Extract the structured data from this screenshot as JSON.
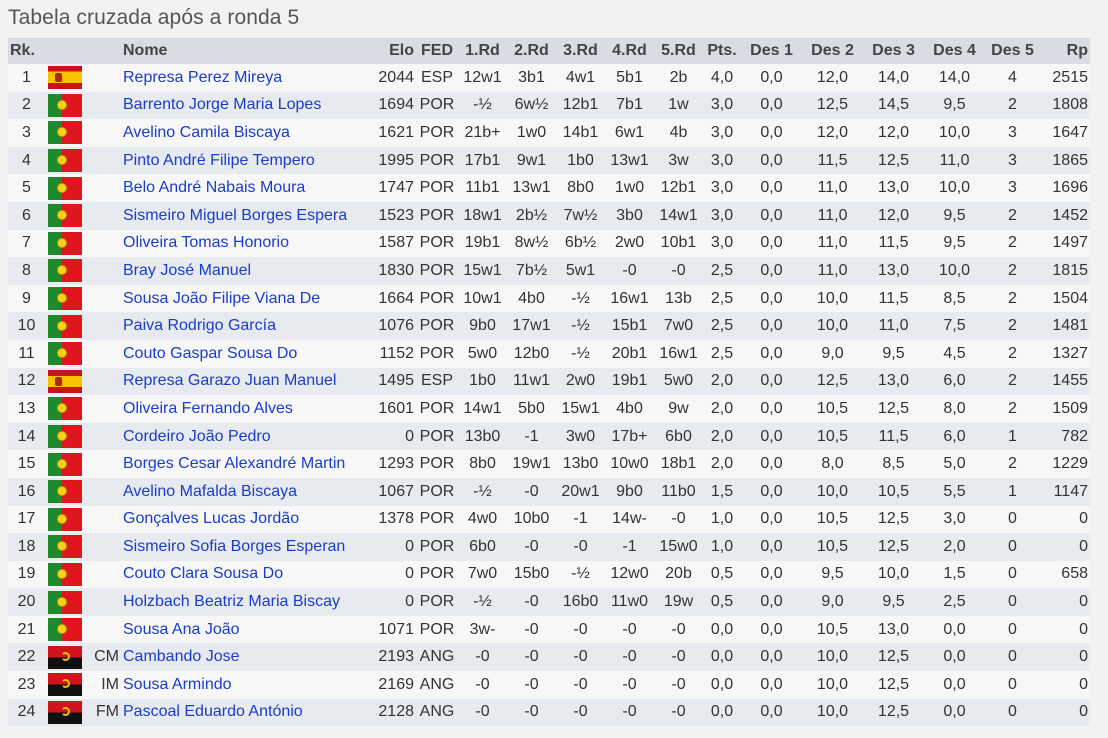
{
  "page": {
    "title": "Tabela cruzada após a ronda 5"
  },
  "columns": [
    "Rk.",
    "",
    "",
    "Nome",
    "Elo",
    "FED",
    "1.Rd",
    "2.Rd",
    "3.Rd",
    "4.Rd",
    "5.Rd",
    "Pts.",
    "Des 1",
    "Des 2",
    "Des 3",
    "Des 4",
    "Des 5",
    "Rp"
  ],
  "rows": [
    {
      "rk": "1",
      "flag": "esp",
      "title": "",
      "name": "Represa Perez Mireya",
      "elo": "2044",
      "fed": "ESP",
      "r1": "12w1",
      "r2": "3b1",
      "r3": "4w1",
      "r4": "5b1",
      "r5": "2b",
      "pts": "4,0",
      "d1": "0,0",
      "d2": "12,0",
      "d3": "14,0",
      "d4": "14,0",
      "d5": "4",
      "rp": "2515"
    },
    {
      "rk": "2",
      "flag": "por",
      "title": "",
      "name": "Barrento Jorge Maria Lopes",
      "elo": "1694",
      "fed": "POR",
      "r1": "-½",
      "r2": "6w½",
      "r3": "12b1",
      "r4": "7b1",
      "r5": "1w",
      "pts": "3,0",
      "d1": "0,0",
      "d2": "12,5",
      "d3": "14,5",
      "d4": "9,5",
      "d5": "2",
      "rp": "1808"
    },
    {
      "rk": "3",
      "flag": "por",
      "title": "",
      "name": "Avelino Camila Biscaya",
      "elo": "1621",
      "fed": "POR",
      "r1": "21b+",
      "r2": "1w0",
      "r3": "14b1",
      "r4": "6w1",
      "r5": "4b",
      "pts": "3,0",
      "d1": "0,0",
      "d2": "12,0",
      "d3": "12,0",
      "d4": "10,0",
      "d5": "3",
      "rp": "1647"
    },
    {
      "rk": "4",
      "flag": "por",
      "title": "",
      "name": "Pinto André Filipe Tempero",
      "elo": "1995",
      "fed": "POR",
      "r1": "17b1",
      "r2": "9w1",
      "r3": "1b0",
      "r4": "13w1",
      "r5": "3w",
      "pts": "3,0",
      "d1": "0,0",
      "d2": "11,5",
      "d3": "12,5",
      "d4": "11,0",
      "d5": "3",
      "rp": "1865"
    },
    {
      "rk": "5",
      "flag": "por",
      "title": "",
      "name": "Belo André Nabais Moura",
      "elo": "1747",
      "fed": "POR",
      "r1": "11b1",
      "r2": "13w1",
      "r3": "8b0",
      "r4": "1w0",
      "r5": "12b1",
      "pts": "3,0",
      "d1": "0,0",
      "d2": "11,0",
      "d3": "13,0",
      "d4": "10,0",
      "d5": "3",
      "rp": "1696"
    },
    {
      "rk": "6",
      "flag": "por",
      "title": "",
      "name": "Sismeiro Miguel Borges Espera",
      "elo": "1523",
      "fed": "POR",
      "r1": "18w1",
      "r2": "2b½",
      "r3": "7w½",
      "r4": "3b0",
      "r5": "14w1",
      "pts": "3,0",
      "d1": "0,0",
      "d2": "11,0",
      "d3": "12,0",
      "d4": "9,5",
      "d5": "2",
      "rp": "1452"
    },
    {
      "rk": "7",
      "flag": "por",
      "title": "",
      "name": "Oliveira Tomas Honorio",
      "elo": "1587",
      "fed": "POR",
      "r1": "19b1",
      "r2": "8w½",
      "r3": "6b½",
      "r4": "2w0",
      "r5": "10b1",
      "pts": "3,0",
      "d1": "0,0",
      "d2": "11,0",
      "d3": "11,5",
      "d4": "9,5",
      "d5": "2",
      "rp": "1497"
    },
    {
      "rk": "8",
      "flag": "por",
      "title": "",
      "name": "Bray José Manuel",
      "elo": "1830",
      "fed": "POR",
      "r1": "15w1",
      "r2": "7b½",
      "r3": "5w1",
      "r4": "-0",
      "r5": "-0",
      "pts": "2,5",
      "d1": "0,0",
      "d2": "11,0",
      "d3": "13,0",
      "d4": "10,0",
      "d5": "2",
      "rp": "1815"
    },
    {
      "rk": "9",
      "flag": "por",
      "title": "",
      "name": "Sousa João Filipe Viana De",
      "elo": "1664",
      "fed": "POR",
      "r1": "10w1",
      "r2": "4b0",
      "r3": "-½",
      "r4": "16w1",
      "r5": "13b",
      "pts": "2,5",
      "d1": "0,0",
      "d2": "10,0",
      "d3": "11,5",
      "d4": "8,5",
      "d5": "2",
      "rp": "1504"
    },
    {
      "rk": "10",
      "flag": "por",
      "title": "",
      "name": "Paiva Rodrigo García",
      "elo": "1076",
      "fed": "POR",
      "r1": "9b0",
      "r2": "17w1",
      "r3": "-½",
      "r4": "15b1",
      "r5": "7w0",
      "pts": "2,5",
      "d1": "0,0",
      "d2": "10,0",
      "d3": "11,0",
      "d4": "7,5",
      "d5": "2",
      "rp": "1481"
    },
    {
      "rk": "11",
      "flag": "por",
      "title": "",
      "name": "Couto Gaspar Sousa Do",
      "elo": "1152",
      "fed": "POR",
      "r1": "5w0",
      "r2": "12b0",
      "r3": "-½",
      "r4": "20b1",
      "r5": "16w1",
      "pts": "2,5",
      "d1": "0,0",
      "d2": "9,0",
      "d3": "9,5",
      "d4": "4,5",
      "d5": "2",
      "rp": "1327"
    },
    {
      "rk": "12",
      "flag": "esp",
      "title": "",
      "name": "Represa Garazo Juan Manuel",
      "elo": "1495",
      "fed": "ESP",
      "r1": "1b0",
      "r2": "11w1",
      "r3": "2w0",
      "r4": "19b1",
      "r5": "5w0",
      "pts": "2,0",
      "d1": "0,0",
      "d2": "12,5",
      "d3": "13,0",
      "d4": "6,0",
      "d5": "2",
      "rp": "1455"
    },
    {
      "rk": "13",
      "flag": "por",
      "title": "",
      "name": "Oliveira Fernando Alves",
      "elo": "1601",
      "fed": "POR",
      "r1": "14w1",
      "r2": "5b0",
      "r3": "15w1",
      "r4": "4b0",
      "r5": "9w",
      "pts": "2,0",
      "d1": "0,0",
      "d2": "10,5",
      "d3": "12,5",
      "d4": "8,0",
      "d5": "2",
      "rp": "1509"
    },
    {
      "rk": "14",
      "flag": "por",
      "title": "",
      "name": "Cordeiro João Pedro",
      "elo": "0",
      "fed": "POR",
      "r1": "13b0",
      "r2": "-1",
      "r3": "3w0",
      "r4": "17b+",
      "r5": "6b0",
      "pts": "2,0",
      "d1": "0,0",
      "d2": "10,5",
      "d3": "11,5",
      "d4": "6,0",
      "d5": "1",
      "rp": "782"
    },
    {
      "rk": "15",
      "flag": "por",
      "title": "",
      "name": "Borges Cesar Alexandré Martin",
      "elo": "1293",
      "fed": "POR",
      "r1": "8b0",
      "r2": "19w1",
      "r3": "13b0",
      "r4": "10w0",
      "r5": "18b1",
      "pts": "2,0",
      "d1": "0,0",
      "d2": "8,0",
      "d3": "8,5",
      "d4": "5,0",
      "d5": "2",
      "rp": "1229"
    },
    {
      "rk": "16",
      "flag": "por",
      "title": "",
      "name": "Avelino Mafalda Biscaya",
      "elo": "1067",
      "fed": "POR",
      "r1": "-½",
      "r2": "-0",
      "r3": "20w1",
      "r4": "9b0",
      "r5": "11b0",
      "pts": "1,5",
      "d1": "0,0",
      "d2": "10,0",
      "d3": "10,5",
      "d4": "5,5",
      "d5": "1",
      "rp": "1147"
    },
    {
      "rk": "17",
      "flag": "por",
      "title": "",
      "name": "Gonçalves Lucas Jordão",
      "elo": "1378",
      "fed": "POR",
      "r1": "4w0",
      "r2": "10b0",
      "r3": "-1",
      "r4": "14w-",
      "r5": "-0",
      "pts": "1,0",
      "d1": "0,0",
      "d2": "10,5",
      "d3": "12,5",
      "d4": "3,0",
      "d5": "0",
      "rp": "0"
    },
    {
      "rk": "18",
      "flag": "por",
      "title": "",
      "name": "Sismeiro Sofia Borges Esperan",
      "elo": "0",
      "fed": "POR",
      "r1": "6b0",
      "r2": "-0",
      "r3": "-0",
      "r4": "-1",
      "r5": "15w0",
      "pts": "1,0",
      "d1": "0,0",
      "d2": "10,5",
      "d3": "12,5",
      "d4": "2,0",
      "d5": "0",
      "rp": "0"
    },
    {
      "rk": "19",
      "flag": "por",
      "title": "",
      "name": "Couto Clara Sousa Do",
      "elo": "0",
      "fed": "POR",
      "r1": "7w0",
      "r2": "15b0",
      "r3": "-½",
      "r4": "12w0",
      "r5": "20b",
      "pts": "0,5",
      "d1": "0,0",
      "d2": "9,5",
      "d3": "10,0",
      "d4": "1,5",
      "d5": "0",
      "rp": "658"
    },
    {
      "rk": "20",
      "flag": "por",
      "title": "",
      "name": "Holzbach Beatriz Maria Biscay",
      "elo": "0",
      "fed": "POR",
      "r1": "-½",
      "r2": "-0",
      "r3": "16b0",
      "r4": "11w0",
      "r5": "19w",
      "pts": "0,5",
      "d1": "0,0",
      "d2": "9,0",
      "d3": "9,5",
      "d4": "2,5",
      "d5": "0",
      "rp": "0"
    },
    {
      "rk": "21",
      "flag": "por",
      "title": "",
      "name": "Sousa Ana João",
      "elo": "1071",
      "fed": "POR",
      "r1": "3w-",
      "r2": "-0",
      "r3": "-0",
      "r4": "-0",
      "r5": "-0",
      "pts": "0,0",
      "d1": "0,0",
      "d2": "10,5",
      "d3": "13,0",
      "d4": "0,0",
      "d5": "0",
      "rp": "0"
    },
    {
      "rk": "22",
      "flag": "ang",
      "title": "CM",
      "name": "Cambando Jose",
      "elo": "2193",
      "fed": "ANG",
      "r1": "-0",
      "r2": "-0",
      "r3": "-0",
      "r4": "-0",
      "r5": "-0",
      "pts": "0,0",
      "d1": "0,0",
      "d2": "10,0",
      "d3": "12,5",
      "d4": "0,0",
      "d5": "0",
      "rp": "0"
    },
    {
      "rk": "23",
      "flag": "ang",
      "title": "IM",
      "name": "Sousa Armindo",
      "elo": "2169",
      "fed": "ANG",
      "r1": "-0",
      "r2": "-0",
      "r3": "-0",
      "r4": "-0",
      "r5": "-0",
      "pts": "0,0",
      "d1": "0,0",
      "d2": "10,0",
      "d3": "12,5",
      "d4": "0,0",
      "d5": "0",
      "rp": "0"
    },
    {
      "rk": "24",
      "flag": "ang",
      "title": "FM",
      "name": "Pascoal Eduardo António",
      "elo": "2128",
      "fed": "ANG",
      "r1": "-0",
      "r2": "-0",
      "r3": "-0",
      "r4": "-0",
      "r5": "-0",
      "pts": "0,0",
      "d1": "0,0",
      "d2": "10,0",
      "d3": "12,5",
      "d4": "0,0",
      "d5": "0",
      "rp": "0"
    }
  ]
}
